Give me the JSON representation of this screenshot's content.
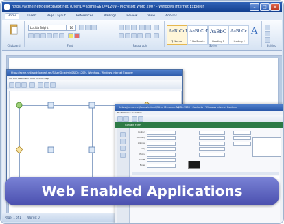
{
  "word": {
    "title": "https://acme.net/desktop/ext.net/?UserID=admin&$ID=1209 - Microsoft Word 2007 - Windows Internet Explorer",
    "tabs": [
      "Home",
      "Insert",
      "Page Layout",
      "References",
      "Mailings",
      "Review",
      "View",
      "Add-Ins"
    ],
    "font_name": "Lucida Bright",
    "font_size": "16",
    "groups": [
      "Clipboard",
      "Font",
      "Paragraph",
      "Styles",
      "Editing"
    ],
    "styles": [
      {
        "sample": "AaBbCcDc",
        "name": "¶ Normal"
      },
      {
        "sample": "AaBbCcDc",
        "name": "¶ No Spaci..."
      },
      {
        "sample": "AaBbC",
        "name": "Heading 1"
      },
      {
        "sample": "AaBbCc",
        "name": "Heading 2"
      }
    ],
    "status": [
      "Page: 1 of 1",
      "Words: 0"
    ]
  },
  "workflow": {
    "title": "https://acme.net/workflow/ext.net/?UserID=admin&$ID=1209 - Workflow - Windows Internet Explorer",
    "menu": "File  Edit  View  Insert  Tools  Window  Help"
  },
  "form": {
    "title": "https://acme.net/forms/ext.net/?UserID=admin&$ID=1209 - Contacts - Windows Internet Explorer",
    "menu": "File  Edit  View  Tools  Help",
    "header": "Contact Form",
    "labels": [
      "Contact",
      "Company",
      "Address",
      "City",
      "Phone",
      "E-mail",
      "Notes"
    ]
  },
  "banner": {
    "text": "Web Enabled Applications"
  },
  "colors": {
    "banner_top": "#7a83d6",
    "banner_bottom": "#4a4fae",
    "titlebar": "#2a58a8",
    "form_header": "#2c7a46"
  }
}
